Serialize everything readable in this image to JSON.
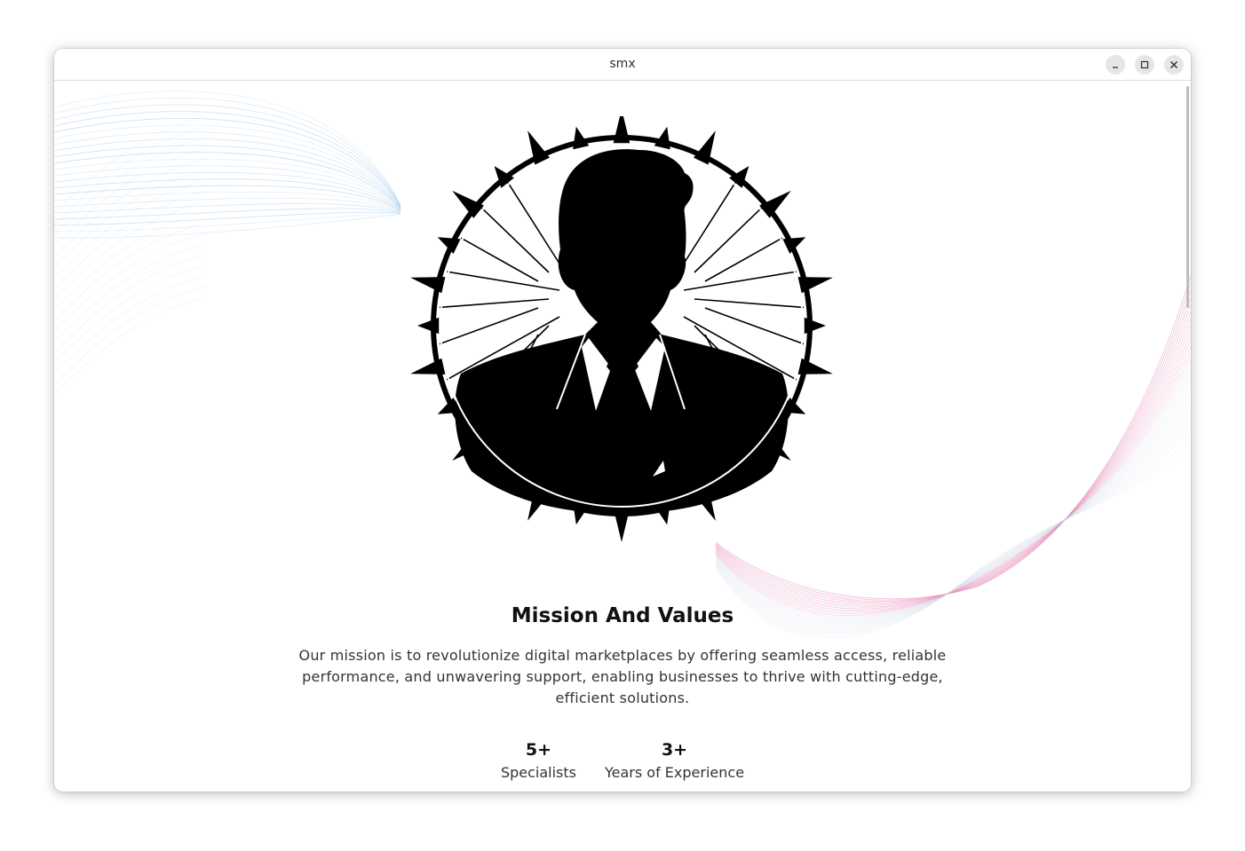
{
  "window": {
    "title": "smx",
    "controls": [
      "minimize-icon",
      "maximize-icon",
      "close-icon"
    ]
  },
  "colors": {
    "wave_blue": "#9cc6ea",
    "wave_pink": "#e58ab8",
    "wave_gray": "#c5cde0",
    "heading": "#111111",
    "body_text": "#333333"
  },
  "hero": {
    "image": "businessman-silhouette-emblem"
  },
  "mission": {
    "title": "Mission And Values",
    "description": "Our mission is to revolutionize digital marketplaces by offering seamless access, reliable performance, and unwavering support, enabling businesses to thrive with cutting-edge, efficient solutions."
  },
  "stats": [
    {
      "value": "5+",
      "label": "Specialists"
    },
    {
      "value": "3+",
      "label": "Years of Experience"
    }
  ]
}
